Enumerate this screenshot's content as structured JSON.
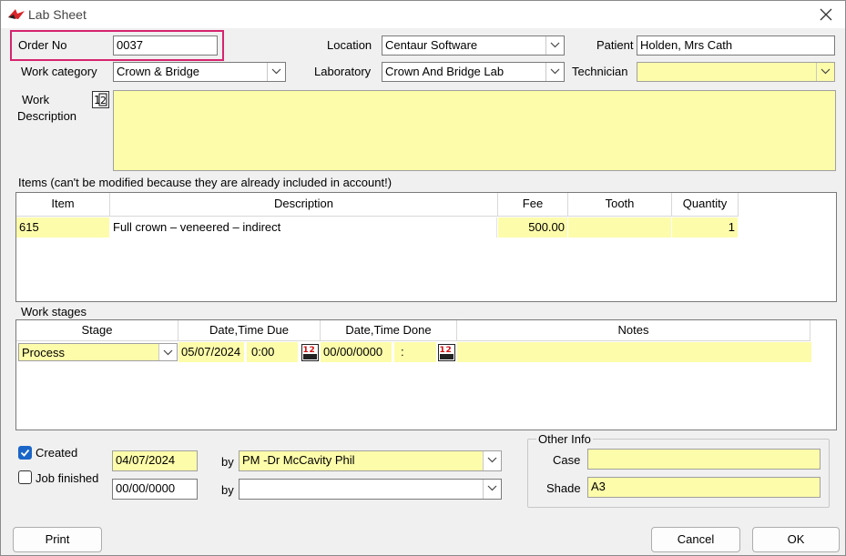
{
  "window": {
    "title": "Lab Sheet"
  },
  "header": {
    "order_no_label": "Order No",
    "order_no_value": "0037",
    "location_label": "Location",
    "location_value": "Centaur Software",
    "patient_label": "Patient",
    "patient_value": "Holden, Mrs Cath",
    "work_category_label": "Work category",
    "work_category_value": "Crown & Bridge",
    "laboratory_label": "Laboratory",
    "laboratory_value": "Crown And Bridge Lab",
    "technician_label": "Technician",
    "technician_value": "",
    "work_description_label_1": "Work",
    "work_description_label_2": "Description",
    "work_description_value": ""
  },
  "items": {
    "caption": "Items (can't be modified because they are already included in account!)",
    "columns": [
      "Item",
      "Description",
      "Fee",
      "Tooth",
      "Quantity"
    ],
    "rows": [
      {
        "item": "615",
        "description": "Full crown – veneered – indirect",
        "fee": "500.00",
        "tooth": "",
        "quantity": "1"
      }
    ]
  },
  "work_stages": {
    "caption": "Work stages",
    "columns": [
      "Stage",
      "Date,Time Due",
      "Date,Time Done",
      "Notes"
    ],
    "rows": [
      {
        "stage": "Process",
        "due_date": "05/07/2024",
        "due_time": "0:00",
        "done_date": "00/00/0000",
        "done_time": ":",
        "notes": ""
      }
    ]
  },
  "status": {
    "created_label": "Created",
    "created_checked": true,
    "created_date": "04/07/2024",
    "created_by_label": "by",
    "created_by_value": "PM -Dr McCavity Phil",
    "finished_label": "Job finished",
    "finished_checked": false,
    "finished_date": "00/00/0000",
    "finished_by_label": "by",
    "finished_by_value": ""
  },
  "other_info": {
    "caption": "Other Info",
    "case_label": "Case",
    "case_value": "",
    "shade_label": "Shade",
    "shade_value": "A3"
  },
  "buttons": {
    "print": "Print",
    "cancel": "Cancel",
    "ok": "OK"
  },
  "colors": {
    "highlight_border": "#d6246e",
    "yellow_field": "#fdfcaa",
    "checkbox_blue": "#1a66c8"
  },
  "icons": [
    "app-logo-icon",
    "close-icon",
    "chevron-down-icon",
    "calculator-icon",
    "numbers-icon",
    "checkmark-icon"
  ]
}
